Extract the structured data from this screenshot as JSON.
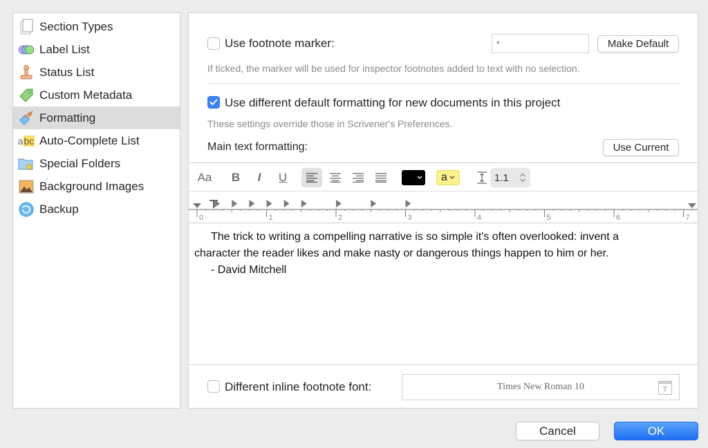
{
  "sidebar": {
    "items": [
      {
        "label": "Section Types",
        "icon": "section-types-icon",
        "selected": false
      },
      {
        "label": "Label List",
        "icon": "label-list-icon",
        "selected": false
      },
      {
        "label": "Status List",
        "icon": "status-stamp-icon",
        "selected": false
      },
      {
        "label": "Custom Metadata",
        "icon": "tag-icon",
        "selected": false
      },
      {
        "label": "Formatting",
        "icon": "paintbrush-icon",
        "selected": true
      },
      {
        "label": "Auto-Complete List",
        "icon": "abc-icon",
        "selected": false
      },
      {
        "label": "Special Folders",
        "icon": "star-folder-icon",
        "selected": false
      },
      {
        "label": "Background Images",
        "icon": "image-icon",
        "selected": false
      },
      {
        "label": "Backup",
        "icon": "backup-icon",
        "selected": false
      }
    ]
  },
  "footnote_marker": {
    "label": "Use footnote marker:",
    "checked": false,
    "placeholder": "*",
    "value": "",
    "make_default_label": "Make Default",
    "hint": "If ticked, the marker will be used for inspector footnotes added to text with no selection."
  },
  "default_formatting": {
    "label": "Use different default formatting for new documents in this project",
    "checked": true,
    "hint": "These settings override those in Scrivener's Preferences.",
    "main_text_label": "Main text formatting:",
    "use_current_label": "Use Current"
  },
  "toolbar": {
    "fonts_label": "Aa",
    "bold_label": "B",
    "italic_label": "I",
    "underline_label": "U",
    "alignment": "left",
    "text_color": "#000000",
    "highlight_label": "a",
    "highlight_color": "#fbf28a",
    "line_spacing": "1.1"
  },
  "ruler": {
    "labels": [
      "0",
      "1",
      "2",
      "3",
      "4",
      "5",
      "6",
      "7"
    ],
    "unit": "inches"
  },
  "editor": {
    "lines": [
      "The trick to writing a compelling narrative is so simple it's often overlooked: invent a",
      "character the reader likes and make nasty or dangerous things happen to him or her.",
      "- David Mitchell"
    ]
  },
  "inline_footnote": {
    "label": "Different inline footnote font:",
    "checked": false,
    "font_value": "Times New Roman 10"
  },
  "dialog_buttons": {
    "cancel_label": "Cancel",
    "ok_label": "OK"
  }
}
